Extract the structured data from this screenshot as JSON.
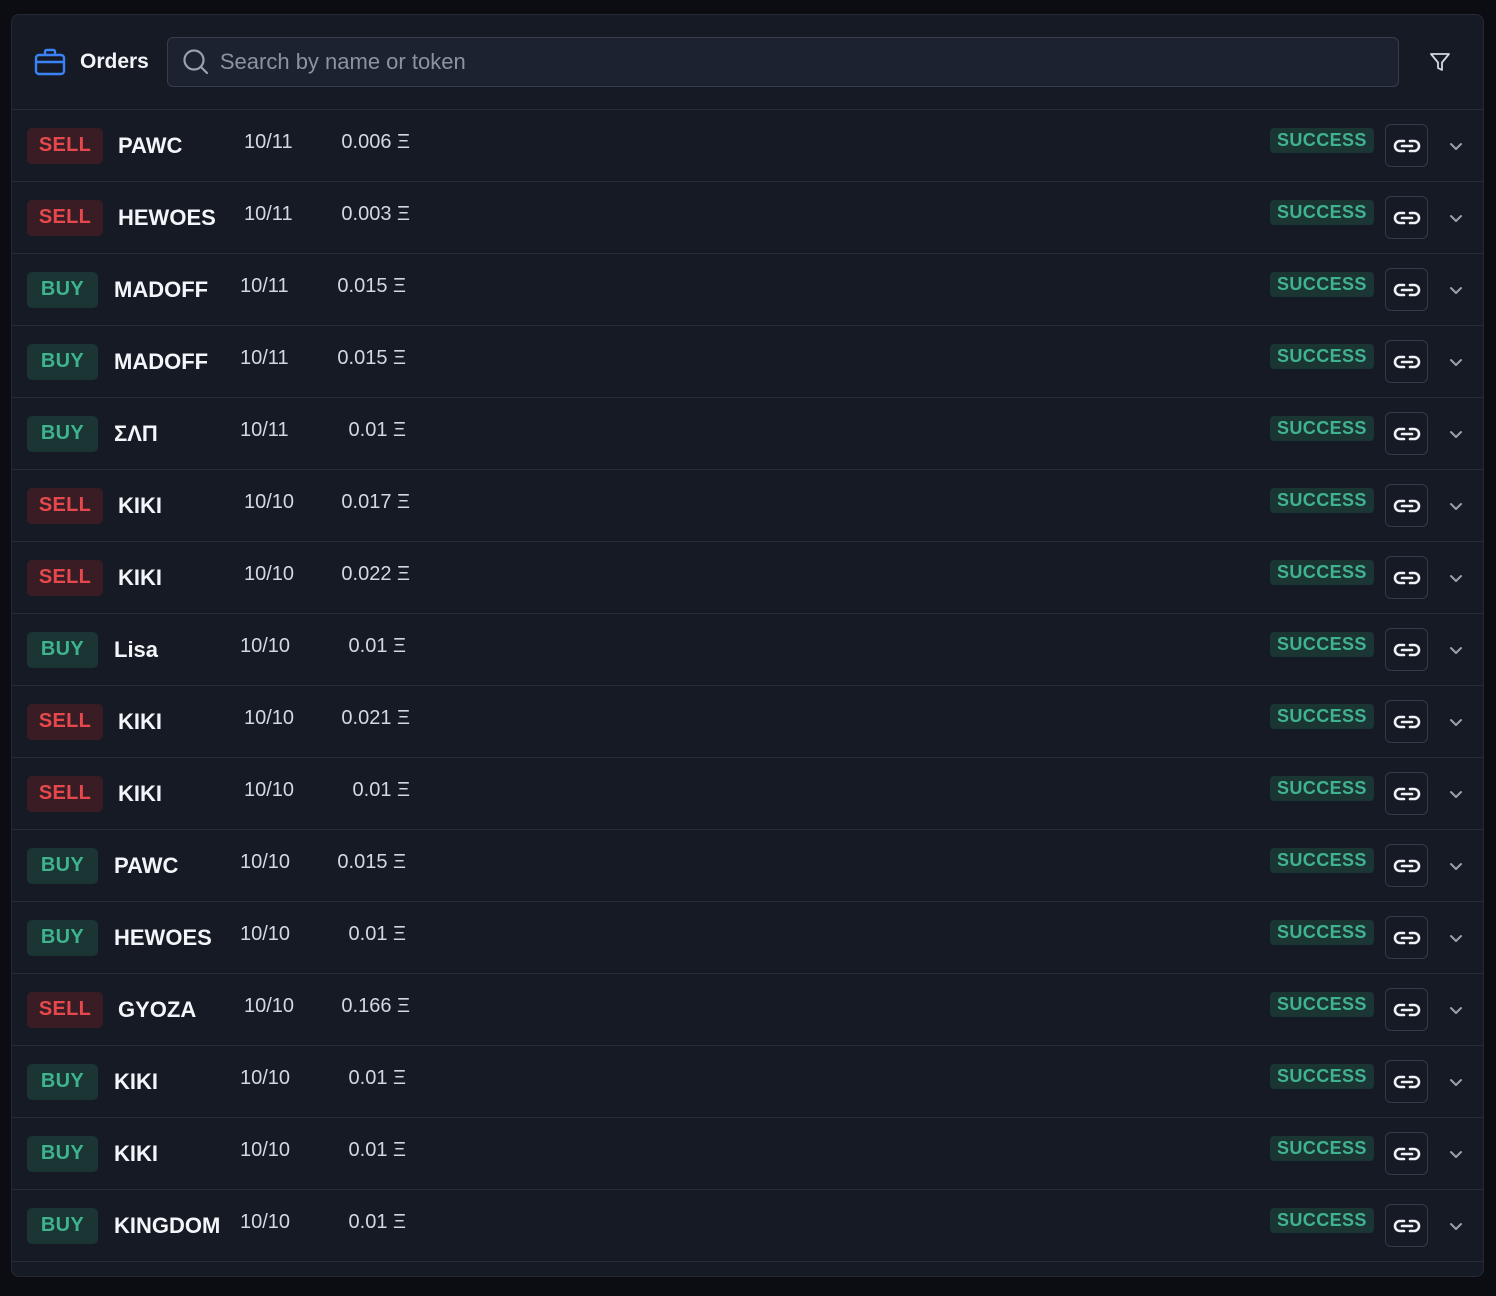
{
  "header": {
    "title": "Orders",
    "search_placeholder": "Search by name or token",
    "search_value": ""
  },
  "icons": {
    "orders": "briefcase-icon",
    "search": "search-icon",
    "filter": "filter-icon",
    "link": "link-icon",
    "expand": "chevron-down-icon"
  },
  "colors": {
    "sell": "#e5484d",
    "buy": "#3fb391",
    "accent": "#3b82f6"
  },
  "orders": [
    {
      "side": "SELL",
      "token": "PAWC",
      "date": "10/11",
      "amount": "0.006 Ξ",
      "status": "SUCCESS"
    },
    {
      "side": "SELL",
      "token": "HEWOES",
      "date": "10/11",
      "amount": "0.003 Ξ",
      "status": "SUCCESS"
    },
    {
      "side": "BUY",
      "token": "MADOFF",
      "date": "10/11",
      "amount": "0.015 Ξ",
      "status": "SUCCESS"
    },
    {
      "side": "BUY",
      "token": "MADOFF",
      "date": "10/11",
      "amount": "0.015 Ξ",
      "status": "SUCCESS"
    },
    {
      "side": "BUY",
      "token": "ΣΛΠ",
      "date": "10/11",
      "amount": "0.01 Ξ",
      "status": "SUCCESS"
    },
    {
      "side": "SELL",
      "token": "KIKI",
      "date": "10/10",
      "amount": "0.017 Ξ",
      "status": "SUCCESS"
    },
    {
      "side": "SELL",
      "token": "KIKI",
      "date": "10/10",
      "amount": "0.022 Ξ",
      "status": "SUCCESS"
    },
    {
      "side": "BUY",
      "token": "Lisa",
      "date": "10/10",
      "amount": "0.01 Ξ",
      "status": "SUCCESS"
    },
    {
      "side": "SELL",
      "token": "KIKI",
      "date": "10/10",
      "amount": "0.021 Ξ",
      "status": "SUCCESS"
    },
    {
      "side": "SELL",
      "token": "KIKI",
      "date": "10/10",
      "amount": "0.01 Ξ",
      "status": "SUCCESS"
    },
    {
      "side": "BUY",
      "token": "PAWC",
      "date": "10/10",
      "amount": "0.015 Ξ",
      "status": "SUCCESS"
    },
    {
      "side": "BUY",
      "token": "HEWOES",
      "date": "10/10",
      "amount": "0.01 Ξ",
      "status": "SUCCESS"
    },
    {
      "side": "SELL",
      "token": "GYOZA",
      "date": "10/10",
      "amount": "0.166 Ξ",
      "status": "SUCCESS"
    },
    {
      "side": "BUY",
      "token": "KIKI",
      "date": "10/10",
      "amount": "0.01 Ξ",
      "status": "SUCCESS"
    },
    {
      "side": "BUY",
      "token": "KIKI",
      "date": "10/10",
      "amount": "0.01 Ξ",
      "status": "SUCCESS"
    },
    {
      "side": "BUY",
      "token": "KINGDOM",
      "date": "10/10",
      "amount": "0.01 Ξ",
      "status": "SUCCESS"
    }
  ]
}
